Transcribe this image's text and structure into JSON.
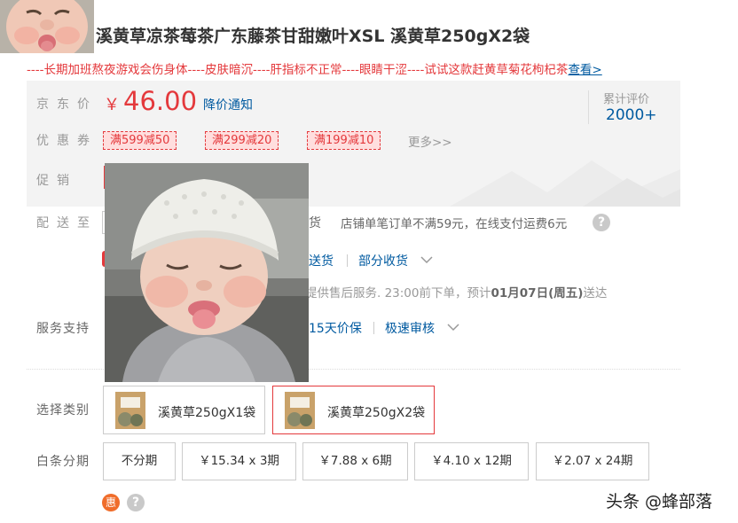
{
  "header": {
    "title": "溪黄草凉茶莓茶广东藤茶甘甜嫩叶XSL 溪黄草250gX2袋",
    "promo_text": "----长期加班熬夜游戏会伤身体----皮肤暗沉----肝指标不正常----眼睛干涩----试试这款赶黄草菊花枸杞茶",
    "promo_link": "查看>"
  },
  "price": {
    "label": "京东价",
    "currency": "￥",
    "value": "46.00",
    "notice_link": "降价通知"
  },
  "reviews": {
    "label": "累计评价",
    "count": "2000+"
  },
  "coupons": {
    "label": "优惠券",
    "items": [
      "满599减50",
      "满299减20",
      "满199减10"
    ],
    "more": "更多>>"
  },
  "promotion": {
    "label": "促销"
  },
  "shipping": {
    "label": "配送至",
    "stock_tail": "货",
    "fee_note": "店铺单笔订单不满59元，在线支付运费6元",
    "delivery_link": "送货",
    "partial_link": "部分收货",
    "after_sales_note_prefix": "提供售后服务. 23:00前下单，预计",
    "after_sales_note_date": "01月07日(周五)",
    "after_sales_note_suffix": "送达"
  },
  "services": {
    "label": "服务支持",
    "price_protect": "15天价保",
    "fast_review": "极速审核"
  },
  "category": {
    "label": "选择类别",
    "variants": [
      {
        "label": "溪黄草250gX1袋",
        "selected": false
      },
      {
        "label": "溪黄草250gX2袋",
        "selected": true
      }
    ]
  },
  "installment": {
    "label": "白条分期",
    "options": [
      "不分期",
      "￥15.34 x 3期",
      "￥7.88 x 6期",
      "￥4.10 x 12期",
      "￥2.07 x 24期"
    ]
  },
  "footer": {
    "hui_icon_text": "惠",
    "help_icon_text": "?"
  },
  "watermark": "头条 @蜂部落",
  "colors": {
    "accent_red": "#e4393c",
    "link_blue": "#005aa0",
    "panel_gray": "#f3f3f3",
    "hui_orange": "#f06d2b"
  },
  "icons": {
    "help": "question-circle-icon",
    "chevron": "chevron-down-icon",
    "hui": "discount-badge-icon"
  }
}
